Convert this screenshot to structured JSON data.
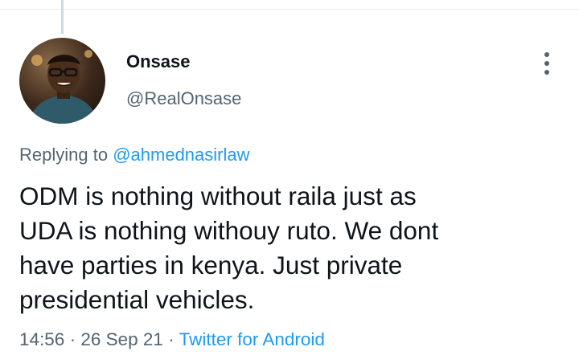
{
  "tweet": {
    "author": {
      "display_name": "Onsase",
      "handle": "@RealOnsase",
      "avatar_icon": "user-avatar-photo"
    },
    "replying_prefix": "Replying to",
    "replying_to": "@ahmednasirlaw",
    "text": "ODM is nothing without raila just as\nUDA is nothing withouy ruto. We dont\nhave parties in kenya. Just private\npresidential vehicles.",
    "time": "14:56",
    "separator": "·",
    "date": "26 Sep 21",
    "source": "Twitter for Android",
    "more_icon": "more-vertical-icon"
  },
  "colors": {
    "text_primary": "#0f1419",
    "text_secondary": "#536471",
    "link": "#1d9bf0",
    "divider": "#e6ecf0"
  }
}
